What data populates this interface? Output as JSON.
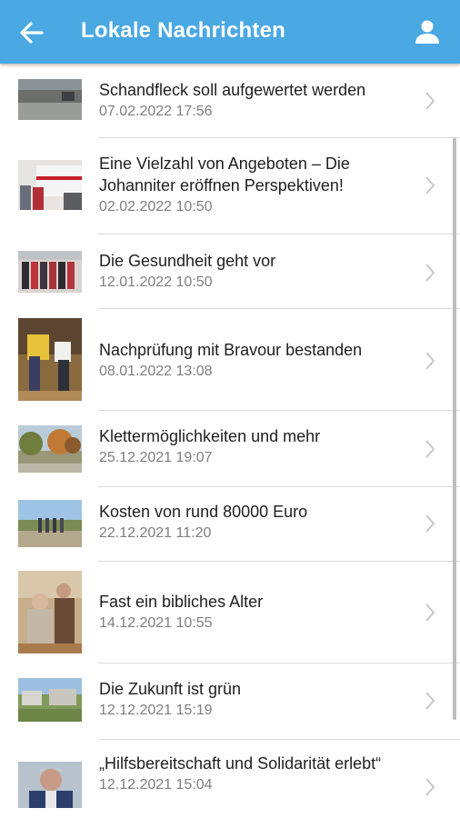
{
  "header": {
    "title": "Lokale Nachrichten",
    "back_icon": "arrow-left-icon",
    "profile_icon": "user-icon"
  },
  "colors": {
    "appbar": "#4aa8e3",
    "headline": "#1f1f1f",
    "date": "#7f7f7f",
    "chevron": "#c7c7cc"
  },
  "articles": [
    {
      "title": "Schandfleck soll aufgewertet werden",
      "date": "07.02.2022 17:56"
    },
    {
      "title": "Eine Vielzahl von Angeboten – Die Johanniter eröffnen Perspektiven!",
      "date": "02.02.2022 10:50"
    },
    {
      "title": "Die Gesundheit geht vor",
      "date": "12.01.2022 10:50"
    },
    {
      "title": "Nachprüfung mit Bravour bestanden",
      "date": "08.01.2022 13:08"
    },
    {
      "title": "Klettermöglichkeiten und mehr",
      "date": "25.12.2021 19:07"
    },
    {
      "title": "Kosten von rund 80000 Euro",
      "date": "22.12.2021 11:20"
    },
    {
      "title": "Fast ein bibliches Alter",
      "date": "14.12.2021 10:55"
    },
    {
      "title": "Die Zukunft ist grün",
      "date": "12.12.2021 15:19"
    },
    {
      "title": "„Hilfsbereitschaft und Solidarität erlebt“",
      "date": "12.12.2021 15:04"
    }
  ]
}
